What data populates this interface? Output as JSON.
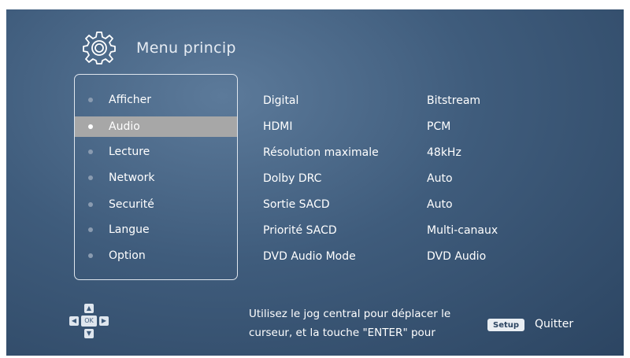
{
  "header": {
    "title": "Menu princip",
    "icon": "gear-icon"
  },
  "menu": {
    "items": [
      {
        "label": "Afficher",
        "active": false
      },
      {
        "label": "Audio",
        "active": true
      },
      {
        "label": "Lecture",
        "active": false
      },
      {
        "label": "Network",
        "active": false
      },
      {
        "label": "Securité",
        "active": false
      },
      {
        "label": "Langue",
        "active": false
      },
      {
        "label": "Option",
        "active": false
      }
    ]
  },
  "settings": [
    {
      "name": "Digital",
      "value": "Bitstream"
    },
    {
      "name": "HDMI",
      "value": "PCM"
    },
    {
      "name": "Résolution maximale",
      "value": "48kHz"
    },
    {
      "name": "Dolby DRC",
      "value": "Auto"
    },
    {
      "name": "Sortie SACD",
      "value": "Auto"
    },
    {
      "name": "Priorité SACD",
      "value": "Multi-canaux"
    },
    {
      "name": "DVD Audio Mode",
      "value": "DVD Audio"
    }
  ],
  "footer": {
    "dpad": {
      "up": "▲",
      "down": "▼",
      "left": "◀",
      "right": "▶",
      "ok": "OK"
    },
    "help_line1": "Utilisez le jog central pour déplacer le",
    "help_line2": "curseur, et la touche \"ENTER\" pour",
    "setup_label": "Setup",
    "quit_label": "Quitter"
  },
  "colors": {
    "background": "#3f5c7c",
    "highlight": "#a7a7a7",
    "text": "#ffffff"
  }
}
